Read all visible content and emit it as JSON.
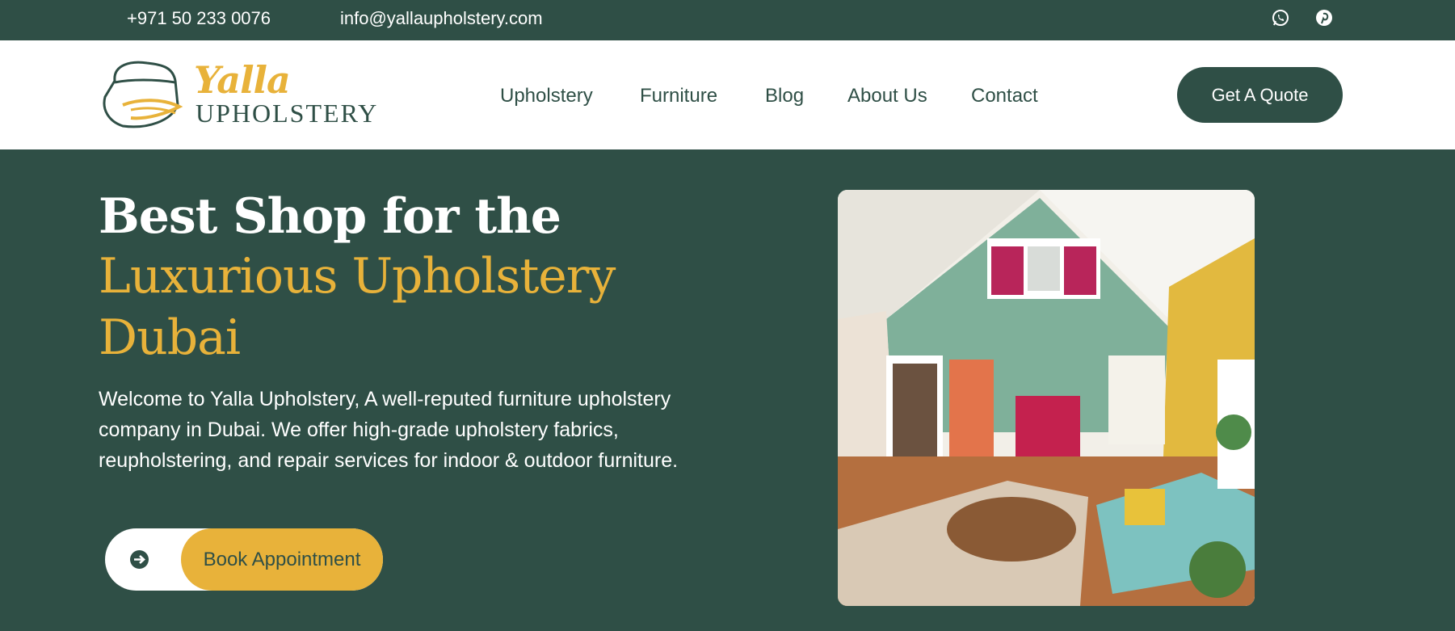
{
  "topbar": {
    "phone": "+971 50 233 0076",
    "email": "info@yallaupholstery.com",
    "social": [
      {
        "icon": "whatsapp-icon"
      },
      {
        "icon": "pinterest-icon"
      }
    ]
  },
  "brand": {
    "logo_word": "Yalla",
    "logo_sub": "UPHOLSTERY"
  },
  "nav": {
    "items": [
      "Upholstery",
      "Furniture",
      "Blog",
      "About Us",
      "Contact"
    ],
    "cta": "Get A Quote"
  },
  "hero": {
    "headline_1": "Best Shop for the",
    "headline_2": "Luxurious Upholstery",
    "headline_3": "Dubai",
    "intro": "Welcome to Yalla Upholstery, A well-reputed furniture upholstery company in Dubai. We offer high-grade upholstery fabrics, reupholstering, and repair services for indoor & outdoor furniture.",
    "button": "Book Appointment",
    "button_icon": "arrow-right-circle-icon"
  },
  "colors": {
    "primary": "#2f4f46",
    "accent": "#e8b23a",
    "white": "#ffffff"
  }
}
